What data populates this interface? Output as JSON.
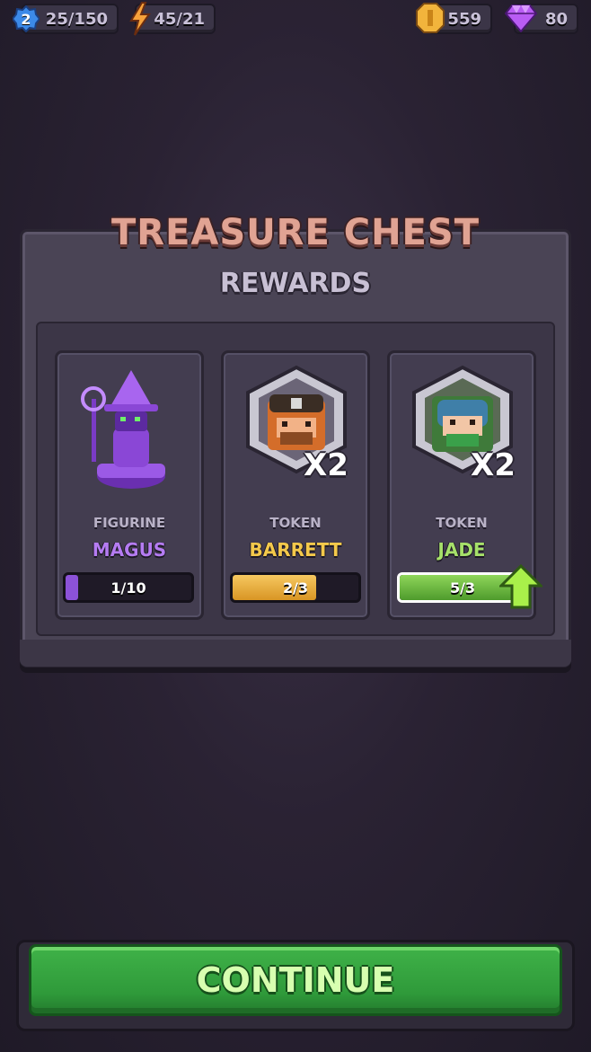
{
  "hud": {
    "level": "2",
    "xp": "25/150",
    "energy": "45/21",
    "coins": "559",
    "gems": "80",
    "icons": [
      "gear-level-badge-icon",
      "lightning-icon",
      "coin-icon",
      "gem-icon"
    ]
  },
  "panel": {
    "title": "TREASURE CHEST",
    "subtitle": "REWARDS"
  },
  "rewards": [
    {
      "type": "FIGURINE",
      "name": "MAGUS",
      "name_color": "#b57cf2",
      "progress_text": "1/10",
      "progress": 0.1,
      "bar_color": "#8c52d8",
      "icon": "magus-figurine-icon"
    },
    {
      "type": "TOKEN",
      "name": "BARRETT",
      "name_color": "#f4c94b",
      "progress_text": "2/3",
      "progress": 0.667,
      "bar_color": "#e2a93a",
      "quantity": "X2",
      "icon": "barrett-token-icon"
    },
    {
      "type": "TOKEN",
      "name": "JADE",
      "name_color": "#a6e06a",
      "progress_text": "5/3",
      "progress": 1.0,
      "bar_color": "#68b93a",
      "quantity": "X2",
      "icon": "jade-token-icon",
      "upgrade_available": true
    }
  ],
  "continue_button": {
    "label": "CONTINUE"
  },
  "colors": {
    "background": "#2a2233",
    "panel": "#4a4455",
    "continue_green": "#2f9a3a"
  }
}
